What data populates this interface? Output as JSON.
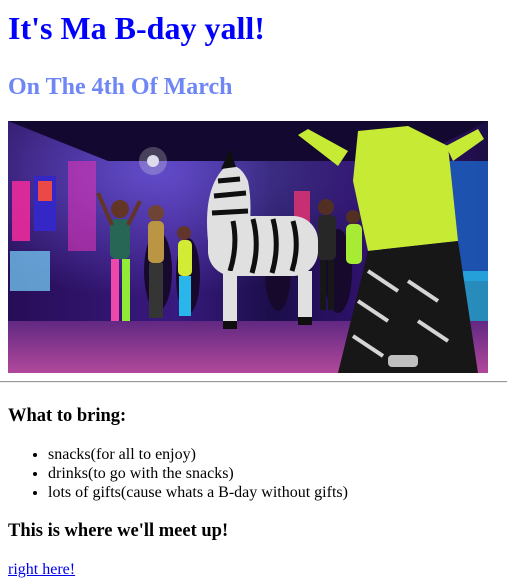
{
  "page": {
    "title": "It's Ma B-day yall!",
    "subtitle": "On The 4th Of March",
    "colors": {
      "title": "#0000ff",
      "subtitle": "#6f86f5",
      "link": "#0000ee"
    }
  },
  "bring": {
    "heading": "What to bring:",
    "items": [
      "snacks(for all to enjoy)",
      "drinks(to go with the snacks)",
      "lots of gifts(cause whats a B-day without gifts)"
    ]
  },
  "meet": {
    "heading": "This is where we'll meet up!",
    "link_text": "right here!"
  }
}
